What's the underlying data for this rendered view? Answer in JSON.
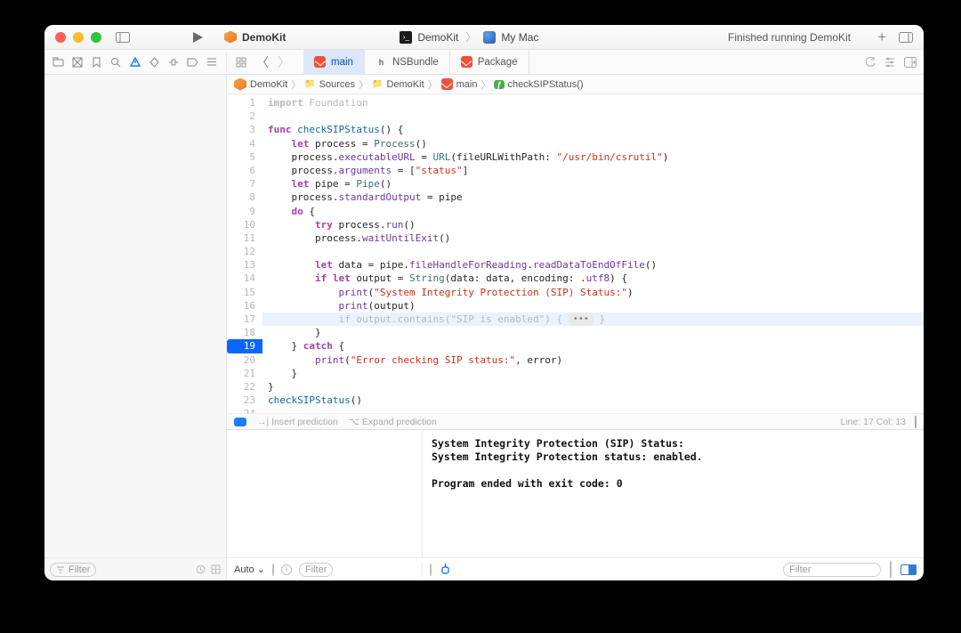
{
  "titlebar": {
    "project": "DemoKit",
    "scheme": "DemoKit",
    "destination": "My Mac",
    "status": "Finished running DemoKit"
  },
  "tabs": [
    {
      "label": "main",
      "kind": "swift",
      "active": true
    },
    {
      "label": "NSBundle",
      "kind": "h",
      "active": false
    },
    {
      "label": "Package",
      "kind": "swift",
      "active": false
    }
  ],
  "jumpbar": {
    "items": [
      "DemoKit",
      "Sources",
      "DemoKit",
      "main",
      "checkSIPStatus()"
    ],
    "icons": [
      "cube",
      "folder",
      "folder",
      "swift",
      "func"
    ]
  },
  "code": {
    "start_line": 1,
    "highlighted_line": 17,
    "marked_line": 19,
    "lines_html": [
      "<span class='faded kw'>import</span><span class='faded'> Foundation</span>",
      "",
      "<span class='kw'>func</span> <span class='fn'>checkSIPStatus</span>() {",
      "    <span class='kw'>let</span> process = <span class='type'>Process</span>()",
      "    process.<span class='call'>executableURL</span> = <span class='type'>URL</span>(fileURLWithPath: <span class='str'>\"/usr/bin/csrutil\"</span>)",
      "    process.<span class='call'>arguments</span> = [<span class='str'>\"status\"</span>]",
      "    <span class='kw'>let</span> pipe = <span class='type'>Pipe</span>()",
      "    process.<span class='call'>standardOutput</span> = pipe",
      "    <span class='kw'>do</span> {",
      "        <span class='kw'>try</span> process.<span class='call'>run</span>()",
      "        process.<span class='call'>waitUntilExit</span>()",
      "",
      "        <span class='kw'>let</span> data = pipe.<span class='call'>fileHandleForReading</span>.<span class='call'>readDataToEndOfFile</span>()",
      "        <span class='kw'>if</span> <span class='kw'>let</span> output = <span class='type'>String</span>(data: data, encoding: .<span class='call'>utf8</span>) {",
      "            <span class='call'>print</span>(<span class='str'>\"System Integrity Protection (SIP) Status:\"</span>)",
      "            <span class='call'>print</span>(output)",
      "            <span class='faded'>if</span><span class='faded'> output.</span><span class='faded'>contains</span><span class='faded'>(</span><span class='str faded'>\"SIP is enabled\"</span><span class='faded'>) { </span><span class='dots-pill'>•••</span><span class='faded'> }</span>",
      "        }",
      "    } <span class='kw'>catch</span> {",
      "        <span class='call'>print</span>(<span class='str'>\"Error checking SIP status:\"</span>, error)",
      "    }",
      "}",
      "<span class='fn'>checkSIPStatus</span>()",
      ""
    ]
  },
  "prediction": {
    "insert": "Insert prediction",
    "expand": "Expand prediction",
    "cursor": "Line: 17  Col: 13"
  },
  "console": {
    "lines": [
      "System Integrity Protection (SIP) Status:",
      "System Integrity Protection status: enabled.",
      "",
      "Program ended with exit code: 0"
    ]
  },
  "footer": {
    "auto": "Auto",
    "filter": "Filter",
    "nav_filter": "Filter"
  }
}
